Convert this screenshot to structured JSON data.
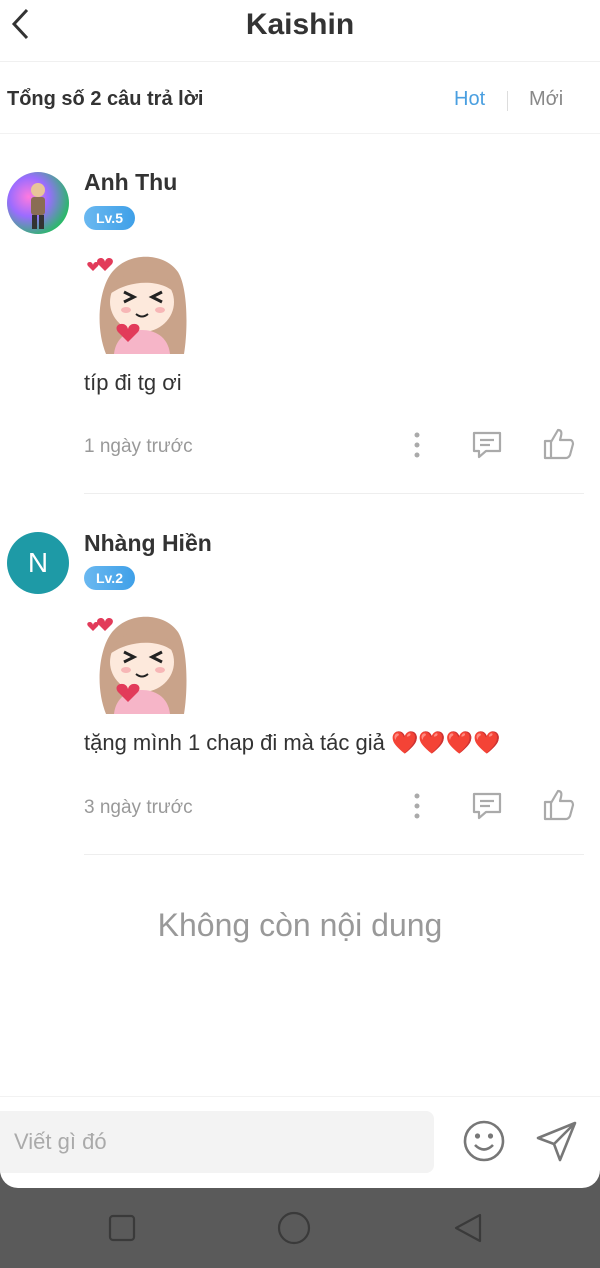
{
  "header": {
    "title": "Kaishin"
  },
  "subbar": {
    "total": "Tổng số 2 câu trả lời",
    "sort_hot": "Hot",
    "sort_new": "Mới"
  },
  "comments": [
    {
      "name": "Anh Thu",
      "level": "Lv.5",
      "text": "típ đi tg ơi",
      "time": "1 ngày trước"
    },
    {
      "name": "Nhàng Hiền",
      "avatar_letter": "N",
      "level": "Lv.2",
      "text": "tặng mình 1 chap đi mà tác giả ❤️❤️❤️❤️",
      "time": "3 ngày trước"
    }
  ],
  "footer": {
    "no_more": "Không còn nội dung"
  },
  "composer": {
    "placeholder": "Viết gì đó"
  },
  "icons": [
    "back-arrow-icon",
    "more-vertical-icon",
    "reply-icon",
    "like-icon",
    "emoji-icon",
    "send-icon",
    "nav-square-icon",
    "nav-circle-icon",
    "nav-triangle-icon"
  ],
  "colors": {
    "accent": "#4a9fe0",
    "level_badge": "#3fa0e8",
    "avatar_n": "#1e9aa6",
    "nav_bg": "#5a5a5a"
  }
}
